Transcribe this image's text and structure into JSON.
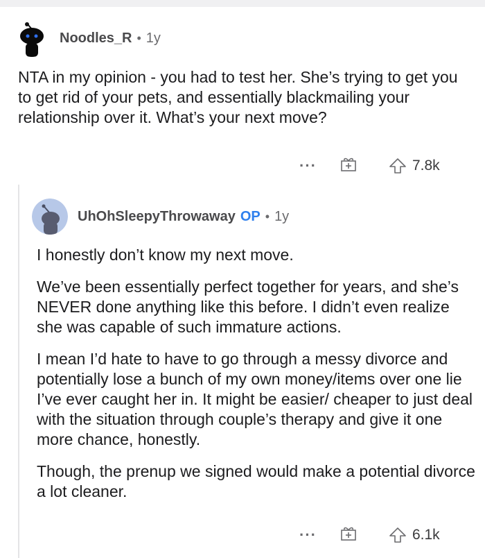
{
  "comment": {
    "username": "Noodles_R",
    "separator": "•",
    "age": "1y",
    "body": "NTA in my opinion - you had to test her. She’s trying to get you to get rid of your pets, and essentially blackmailing your relationship over it. What’s your next move?",
    "more_label": "···",
    "upvotes": "7.8k",
    "avatar_color": "#0a0a0a"
  },
  "reply": {
    "username": "UhOhSleepyThrowaway",
    "op_badge": "OP",
    "separator": "•",
    "age": "1y",
    "paragraphs": [
      "I honestly don’t know my next move.",
      "We’ve been essentially perfect together for years, and she’s NEVER done anything like this before. I didn’t even realize she was capable of such immature actions.",
      "I mean I’d hate to have to go through a messy divorce and potentially lose a bunch of my own money/items over one lie I’ve ever caught her in. It might be easier/ cheaper to just deal with the situation through couple’s therapy and give it one more chance, honestly.",
      "Though, the prenup we signed would make a potential divorce a lot cleaner."
    ],
    "more_label": "···",
    "upvotes": "6.1k",
    "avatar_color": "#b7c8e8"
  },
  "colors": {
    "op_badge": "#2f80ed",
    "thread_line": "#e4e4e6"
  },
  "icons": [
    "more-icon",
    "gift-icon",
    "upvote-icon",
    "snoo-avatar-icon"
  ]
}
